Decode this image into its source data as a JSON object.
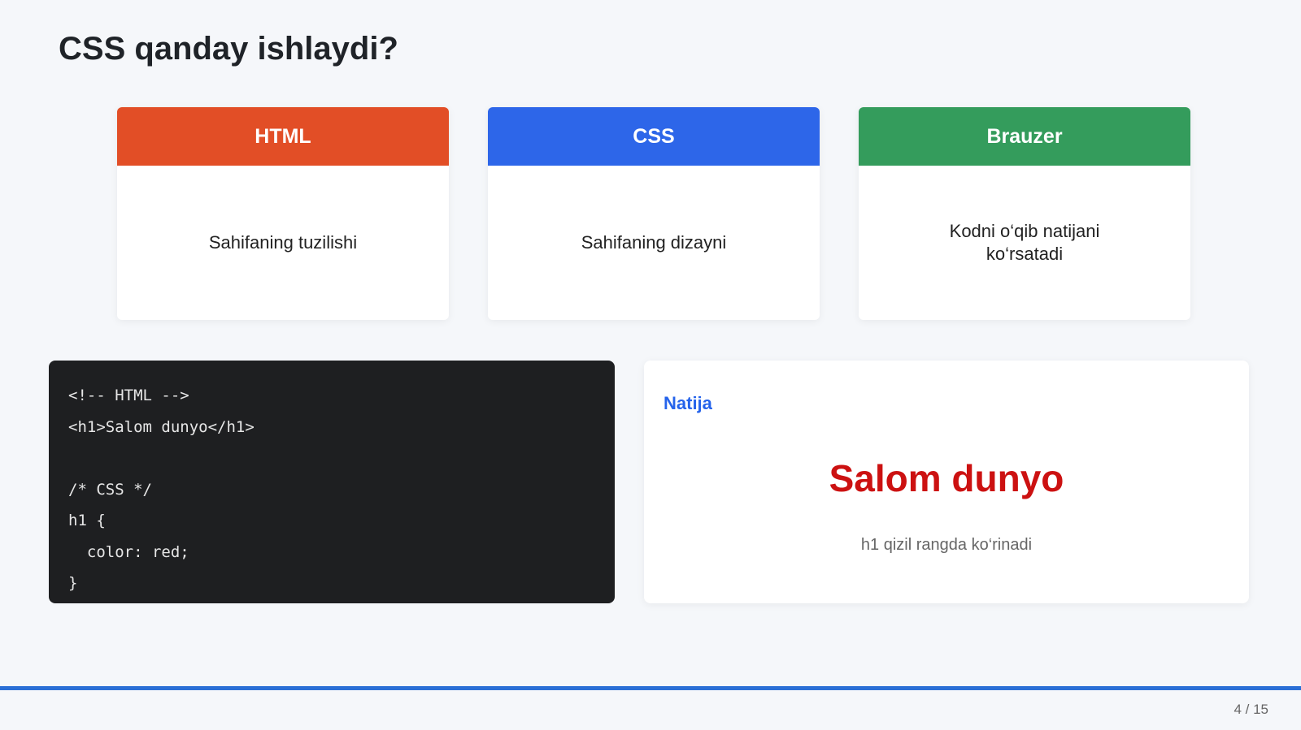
{
  "slide": {
    "title": "CSS qanday ishlaydi?",
    "page_counter": "4 / 15",
    "progress": 1.0
  },
  "cards": [
    {
      "header": "HTML",
      "body": "Sahifaning tuzilishi",
      "color": "#e24e26"
    },
    {
      "header": "CSS",
      "body": "Sahifaning dizayni",
      "color": "#2d66e9"
    },
    {
      "header": "Brauzer",
      "body": "Kodni o‘qib natijani ko‘rsatadi",
      "color": "#349c5c"
    }
  ],
  "code": {
    "lines": [
      "<!-- HTML -->",
      "<h1>Salom dunyo</h1>",
      "",
      "/* CSS */",
      "h1 {",
      "  color: red;",
      "}"
    ]
  },
  "result": {
    "label": "Natija",
    "heading": "Salom dunyo",
    "caption": "h1 qizil rangda ko‘rinadi"
  },
  "colors": {
    "accent": "#2563eb",
    "result_red": "#cc1111",
    "code_bg": "#1e1f21",
    "progress": "#2a6fd6"
  }
}
